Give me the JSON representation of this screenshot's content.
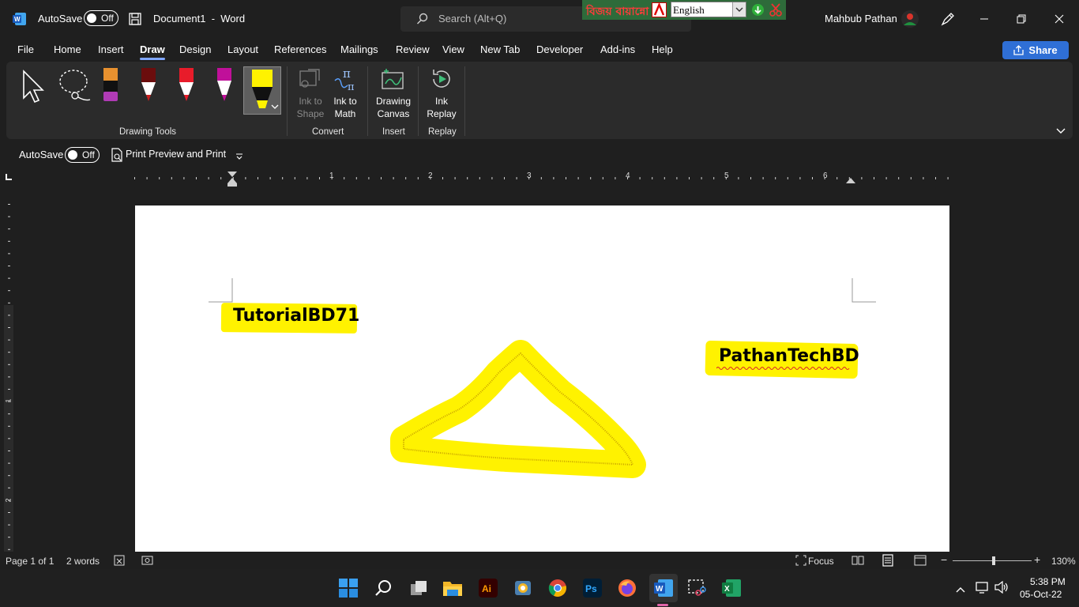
{
  "titlebar": {
    "autosave_label": "AutoSave",
    "autosave_state": "Off",
    "doc_title": "Document1  -  Word",
    "search_placeholder": "Search (Alt+Q)",
    "user_name": "Mahbub Pathan",
    "bijoy_text": "বিজয় বায়ান্নো",
    "bijoy_language": "English"
  },
  "tabs": [
    "File",
    "Home",
    "Insert",
    "Draw",
    "Design",
    "Layout",
    "References",
    "Mailings",
    "Review",
    "View",
    "New Tab",
    "Developer",
    "Add-ins",
    "Help"
  ],
  "active_tab": "Draw",
  "share_label": "Share",
  "ribbon": {
    "groups": {
      "drawing_tools": "Drawing Tools",
      "convert": "Convert",
      "insert": "Insert",
      "replay": "Replay"
    },
    "buttons": {
      "ink_to_shape": [
        "Ink to",
        "Shape"
      ],
      "ink_to_math": [
        "Ink to",
        "Math"
      ],
      "drawing_canvas": [
        "Drawing",
        "Canvas"
      ],
      "ink_replay": [
        "Ink",
        "Replay"
      ]
    },
    "pen_colors": [
      "#e8912f",
      "#c81e1e",
      "#e81c2a",
      "#c0109a",
      "#fff200"
    ]
  },
  "qat": {
    "autosave_label": "AutoSave",
    "autosave_state": "Off",
    "print_preview": "Print Preview and Print"
  },
  "ruler": {
    "h_numbers": [
      "1",
      "2",
      "3",
      "4",
      "5",
      "6"
    ],
    "v_numbers": [
      "1",
      "2"
    ]
  },
  "document": {
    "text1": "TutorialBD71",
    "text2": "PathanTechBD",
    "highlight_color": "#fff200"
  },
  "statusbar": {
    "page": "Page 1 of 1",
    "words": "2 words",
    "focus": "Focus",
    "zoom": "130%"
  },
  "taskbar": {
    "time": "5:38 PM",
    "date": "05-Oct-22"
  }
}
